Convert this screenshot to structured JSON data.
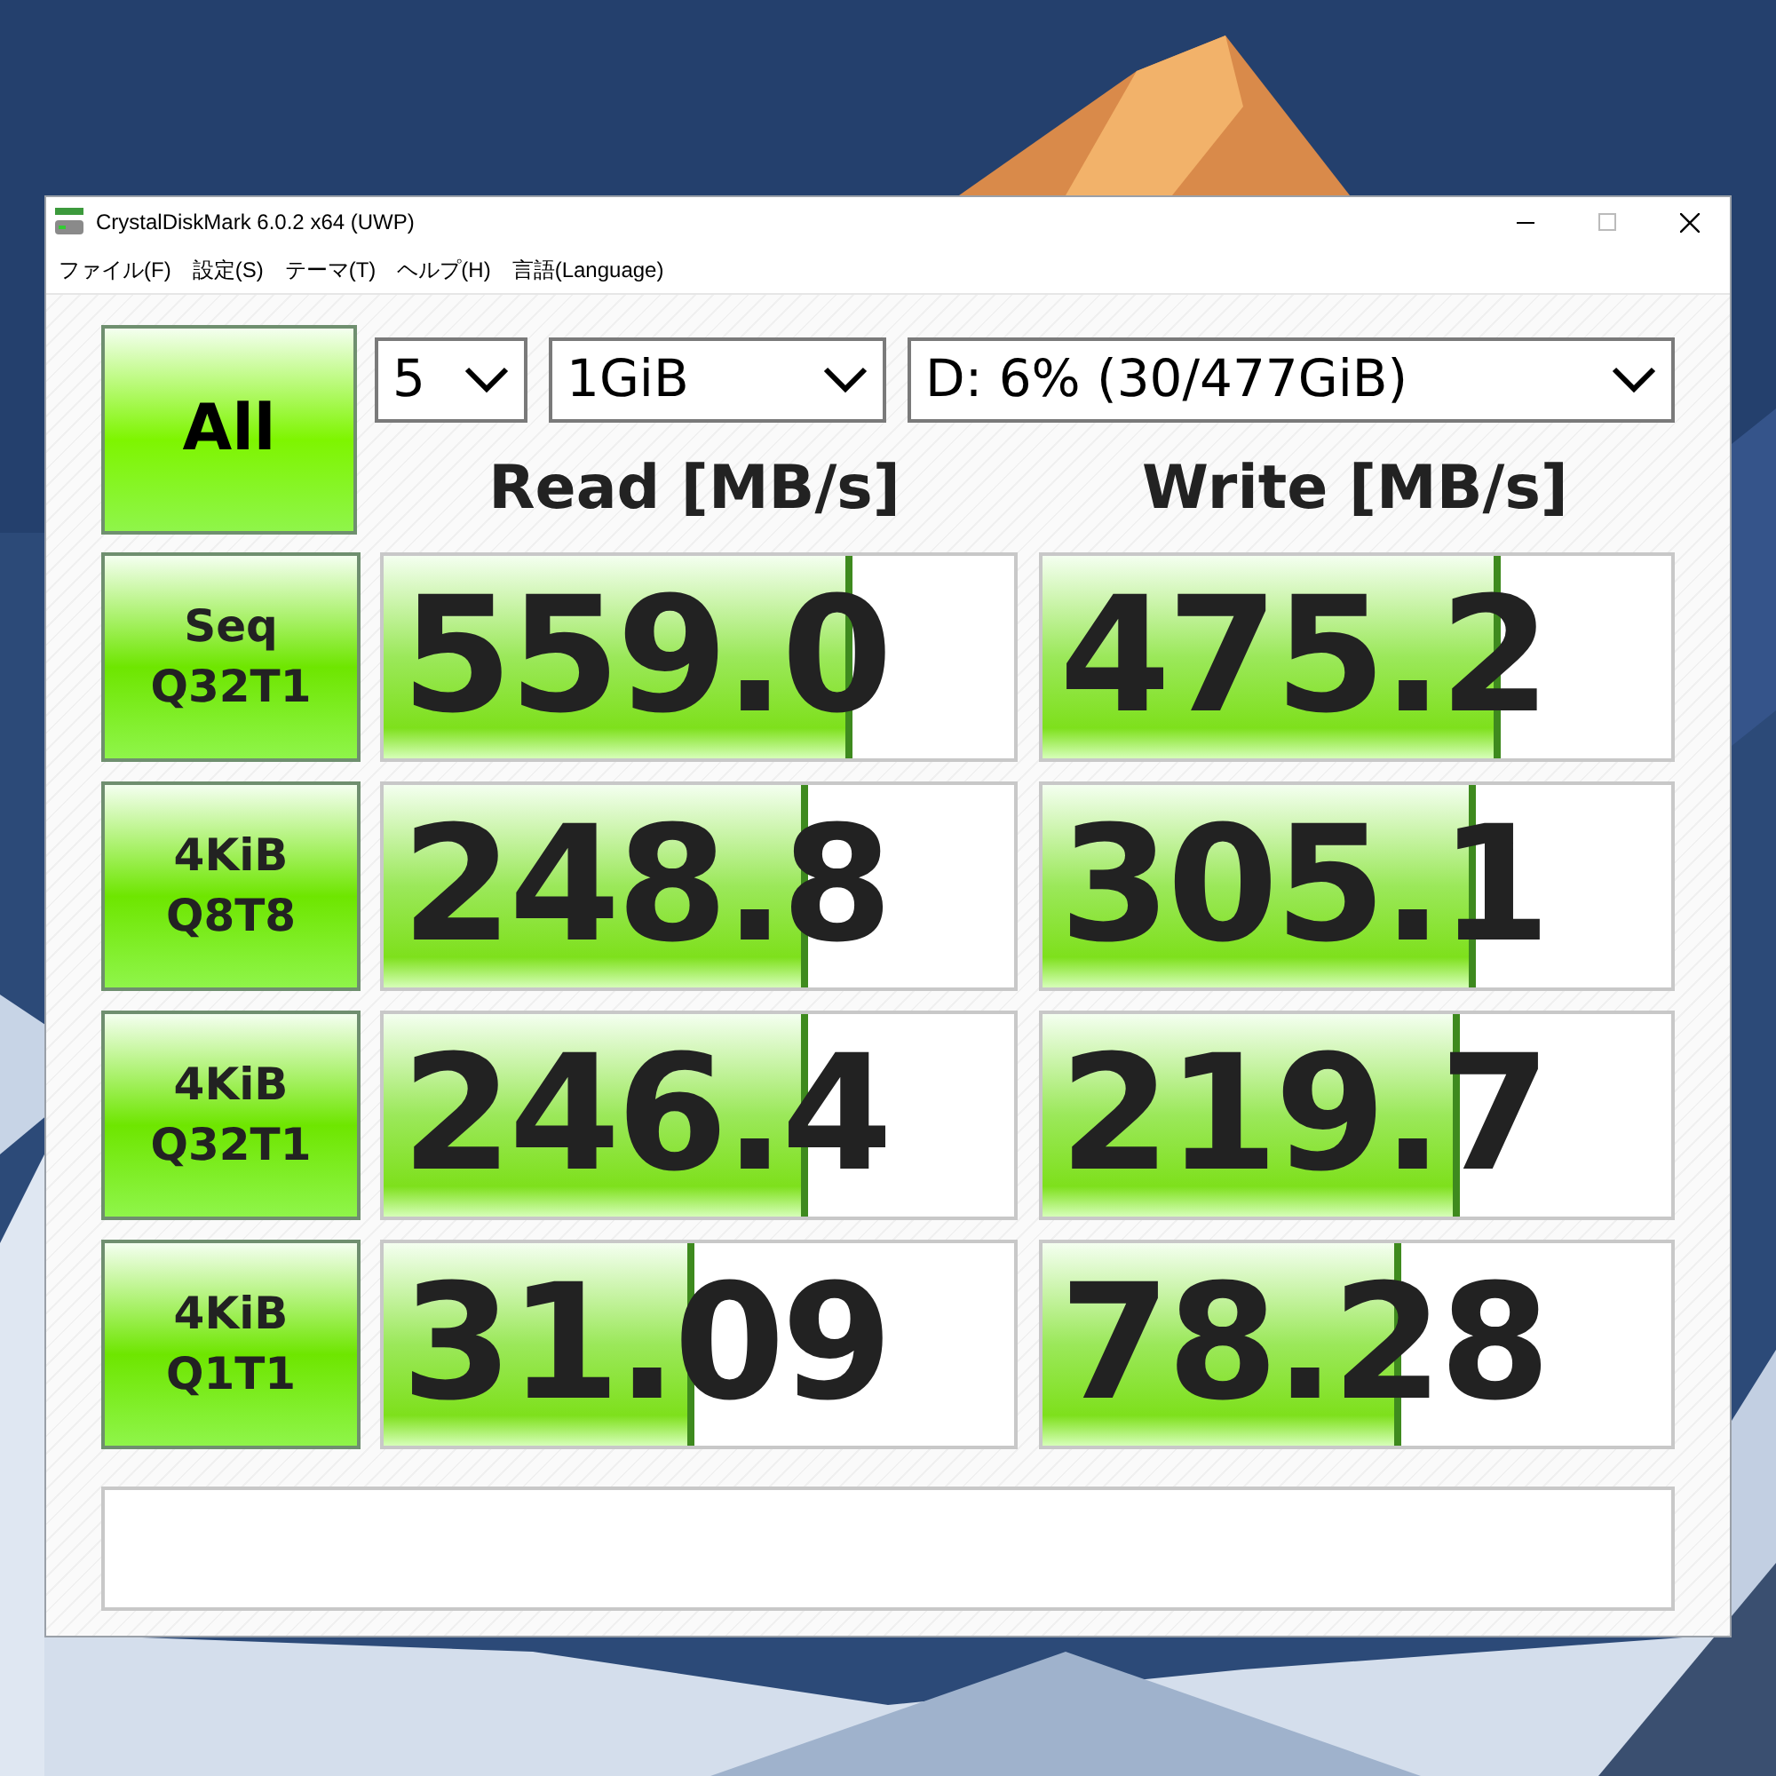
{
  "window": {
    "title": "CrystalDiskMark 6.0.2 x64 (UWP)"
  },
  "menu": [
    "ファイル(F)",
    "設定(S)",
    "テーマ(T)",
    "ヘルプ(H)",
    "言語(Language)"
  ],
  "all_button": "All",
  "selects": [
    {
      "value": "5"
    },
    {
      "value": "1GiB"
    },
    {
      "value": "D: 6% (30/477GiB)"
    }
  ],
  "headers": [
    "Read [MB/s]",
    "Write [MB/s]"
  ],
  "rows": [
    {
      "label": [
        "Seq",
        "Q32T1"
      ],
      "read": {
        "value": "559.0",
        "level": 0.745
      },
      "write": {
        "value": "475.2",
        "level": 0.73
      }
    },
    {
      "label": [
        "4KiB",
        "Q8T8"
      ],
      "read": {
        "value": "248.8",
        "level": 0.675
      },
      "write": {
        "value": "305.1",
        "level": 0.69
      }
    },
    {
      "label": [
        "4KiB",
        "Q32T1"
      ],
      "read": {
        "value": "246.4",
        "level": 0.675
      },
      "write": {
        "value": "219.7",
        "level": 0.665
      }
    },
    {
      "label": [
        "4KiB",
        "Q1T1"
      ],
      "read": {
        "value": "31.09",
        "level": 0.495
      },
      "write": {
        "value": "78.28",
        "level": 0.57
      }
    }
  ]
}
